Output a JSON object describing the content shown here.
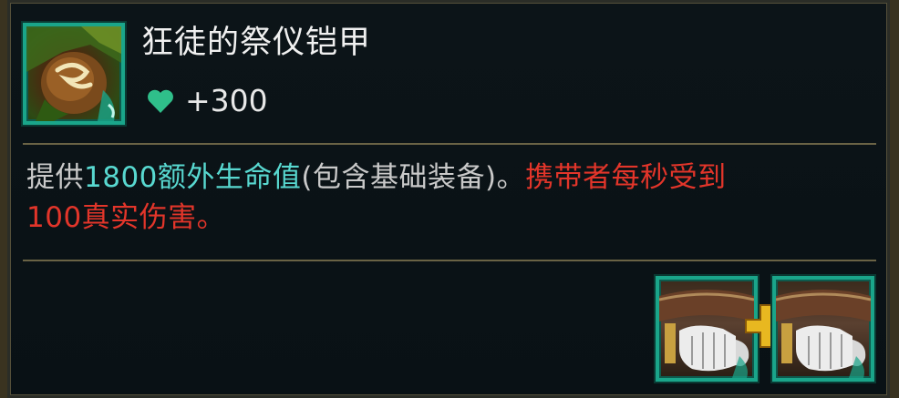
{
  "item": {
    "name": "狂徒的祭仪铠甲",
    "icon": "ritual-armor-icon",
    "stat": {
      "icon": "heart-icon",
      "value": "+300",
      "color": "#2fbf8a"
    }
  },
  "description": {
    "prefix": "提供",
    "highlight": "1800额外生命值",
    "middle": "(包含基础装备)。",
    "warning_line1": "携带者每秒受到",
    "warning_line2": "100真实伤害。"
  },
  "colors": {
    "highlight": "#58d8d0",
    "warning": "#e2352a",
    "frame": "#1aa58a"
  },
  "recipe": {
    "components": [
      {
        "icon": "giants-belt-icon"
      },
      {
        "icon": "giants-belt-icon"
      }
    ],
    "combine_icon": "plus-icon"
  }
}
